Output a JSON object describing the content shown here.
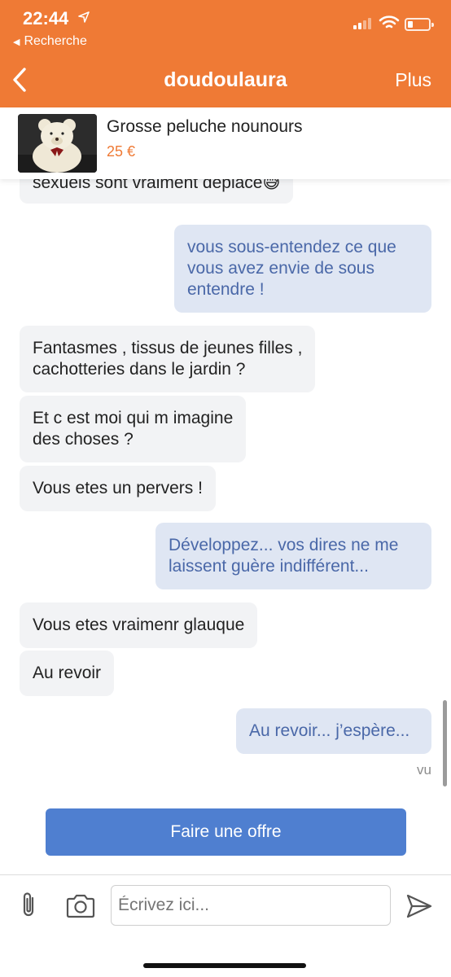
{
  "status_bar": {
    "time": "22:44",
    "back_app": "Recherche",
    "battery_level_percent": 18,
    "icons": [
      "location-arrow-icon",
      "signal-icon",
      "wifi-icon",
      "battery-icon"
    ]
  },
  "header": {
    "title": "doudoulaura",
    "right_action": "Plus",
    "background_color": "#ef7a35"
  },
  "product": {
    "title": "Grosse peluche nounours",
    "price": "25 €"
  },
  "messages": [
    {
      "from": "them",
      "text": "sexuels sont vraiment deplacé😅"
    },
    {
      "from": "me",
      "text": "vous sous-entendez ce que\nvous avez envie de sous\nentendre !"
    },
    {
      "from": "them",
      "text": "Fantasmes , tissus de jeunes filles ,\ncachotteries dans le jardin ?"
    },
    {
      "from": "them",
      "text": "Et c est moi qui m imagine\ndes choses ?"
    },
    {
      "from": "them",
      "text": "Vous etes un pervers !"
    },
    {
      "from": "me",
      "text": "Développez... vos dires ne me\nlaissent guère indifférent..."
    },
    {
      "from": "them",
      "text": "Vous etes vraimenr glauque"
    },
    {
      "from": "them",
      "text": "Au revoir"
    },
    {
      "from": "me",
      "text": "Au revoir... j’espère..."
    }
  ],
  "seen_label": "vu",
  "offer_button": "Faire une offre",
  "composer": {
    "placeholder": "Écrivez ici..."
  },
  "colors": {
    "accent": "#ef7a35",
    "button": "#4f7fd0",
    "outgoing_bubble": "#dfe6f3",
    "incoming_bubble": "#f2f3f5"
  }
}
